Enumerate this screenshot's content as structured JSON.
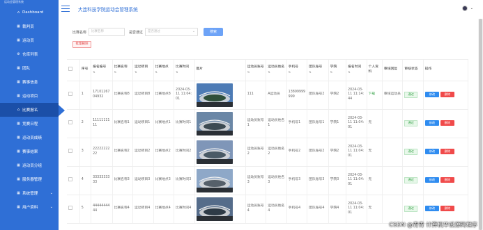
{
  "app": {
    "title": "大连科技学院运动会管理系统"
  },
  "sidebar": {
    "top_label": "运动会管理系统",
    "items": [
      {
        "label": "Dashboard",
        "icon": "home-icon",
        "active": false
      },
      {
        "label": "裁判员",
        "icon": "grid-icon",
        "active": false
      },
      {
        "label": "运动员",
        "icon": "grid-icon",
        "active": false
      },
      {
        "label": "仓库列表",
        "icon": "gear-icon",
        "active": false
      },
      {
        "label": "团队",
        "icon": "grid-icon",
        "active": false
      },
      {
        "label": "赛事信息",
        "icon": "grid-icon",
        "active": false
      },
      {
        "label": "运动项目",
        "icon": "grid-icon",
        "active": false
      },
      {
        "label": "比赛报名",
        "icon": "home-icon",
        "active": true
      },
      {
        "label": "竞赛日程",
        "icon": "grid-icon",
        "active": false
      },
      {
        "label": "运动员成绩",
        "icon": "grid-icon",
        "active": false
      },
      {
        "label": "赛事结果",
        "icon": "grid-icon",
        "active": false
      },
      {
        "label": "运动员分组",
        "icon": "grid-icon",
        "active": false
      },
      {
        "label": "服务器管理",
        "icon": "grid-icon",
        "active": false
      },
      {
        "label": "系统管理",
        "icon": "grid-icon",
        "active": false,
        "expandable": true
      },
      {
        "label": "用户资料",
        "icon": "grid-icon",
        "active": false,
        "expandable": true
      }
    ]
  },
  "search": {
    "name_label": "比赛名称",
    "name_placeholder": "比赛名称",
    "approved_label": "是否通过",
    "approved_placeholder": "是否通过",
    "search_button": "搜索",
    "batch_delete": "批量删除"
  },
  "table": {
    "headers": [
      "序号",
      "报名编号",
      "比赛名称",
      "运动项目",
      "比赛地点",
      "比赛时间",
      "图片",
      "运动员账号",
      "运动员姓名",
      "手机号",
      "团队账号",
      "学院",
      "报名时间",
      "个人资料",
      "审核回复",
      "审核状态",
      "操作"
    ],
    "rows": [
      {
        "no": "1",
        "reg_no": "1710126704932",
        "match_name": "比赛名称8",
        "project": "运动项目8",
        "place": "比赛地点8",
        "time": "2024-03-11 11:04:01",
        "athlete_acc": "111",
        "athlete_name": "A运动员",
        "phone": "13899999999",
        "team_acc": "团队账号2",
        "college": "学院2",
        "reg_time": "2024-03-11 11:14:44",
        "profile": "下载",
        "reply": "审核运动员",
        "status": "通过"
      },
      {
        "no": "2",
        "reg_no": "1111111111",
        "match_name": "比赛名称1",
        "project": "运动项目1",
        "place": "比赛地点1",
        "time": "比赛时间1",
        "athlete_acc": "运动员账号1",
        "athlete_name": "运动员姓名1",
        "phone": "手机号1",
        "team_acc": "团队账号1",
        "college": "学院1",
        "reg_time": "2024-03-11 11:04:01",
        "profile": "无",
        "reply": "",
        "status": "通过"
      },
      {
        "no": "3",
        "reg_no": "2222222222",
        "match_name": "比赛名称2",
        "project": "运动项目2",
        "place": "比赛地点2",
        "time": "比赛时间2",
        "athlete_acc": "运动员账号2",
        "athlete_name": "运动员姓名2",
        "phone": "手机号2",
        "team_acc": "团队账号2",
        "college": "学院2",
        "reg_time": "2024-03-11 11:04:01",
        "profile": "无",
        "reply": "",
        "status": "通过"
      },
      {
        "no": "4",
        "reg_no": "3333333333",
        "match_name": "比赛名称3",
        "project": "运动项目3",
        "place": "比赛地点3",
        "time": "比赛时间3",
        "athlete_acc": "运动员账号3",
        "athlete_name": "运动员姓名3",
        "phone": "手机号3",
        "team_acc": "团队账号3",
        "college": "学院3",
        "reg_time": "2024-03-11 11:04:01",
        "profile": "无",
        "reply": "",
        "status": "通过"
      },
      {
        "no": "5",
        "reg_no": "4444444444",
        "match_name": "比赛名称4",
        "project": "运动项目4",
        "place": "比赛地点4",
        "time": "比赛时间4",
        "athlete_acc": "运动员账号4",
        "athlete_name": "运动员姓名4",
        "phone": "手机号4",
        "team_acc": "团队账号4",
        "college": "学院4",
        "reg_time": "2024-03-11 11:04:01",
        "profile": "无",
        "reply": "",
        "status": "通过"
      }
    ],
    "edit_label": "修改",
    "delete_label": "删除"
  },
  "watermark": "CSDN @青青  计算机毕设源码程序",
  "colors": {
    "sidebar": "#2f6fd6",
    "accent": "#2f8cf0",
    "danger": "#f04a4a",
    "success": "#3aa44c"
  }
}
